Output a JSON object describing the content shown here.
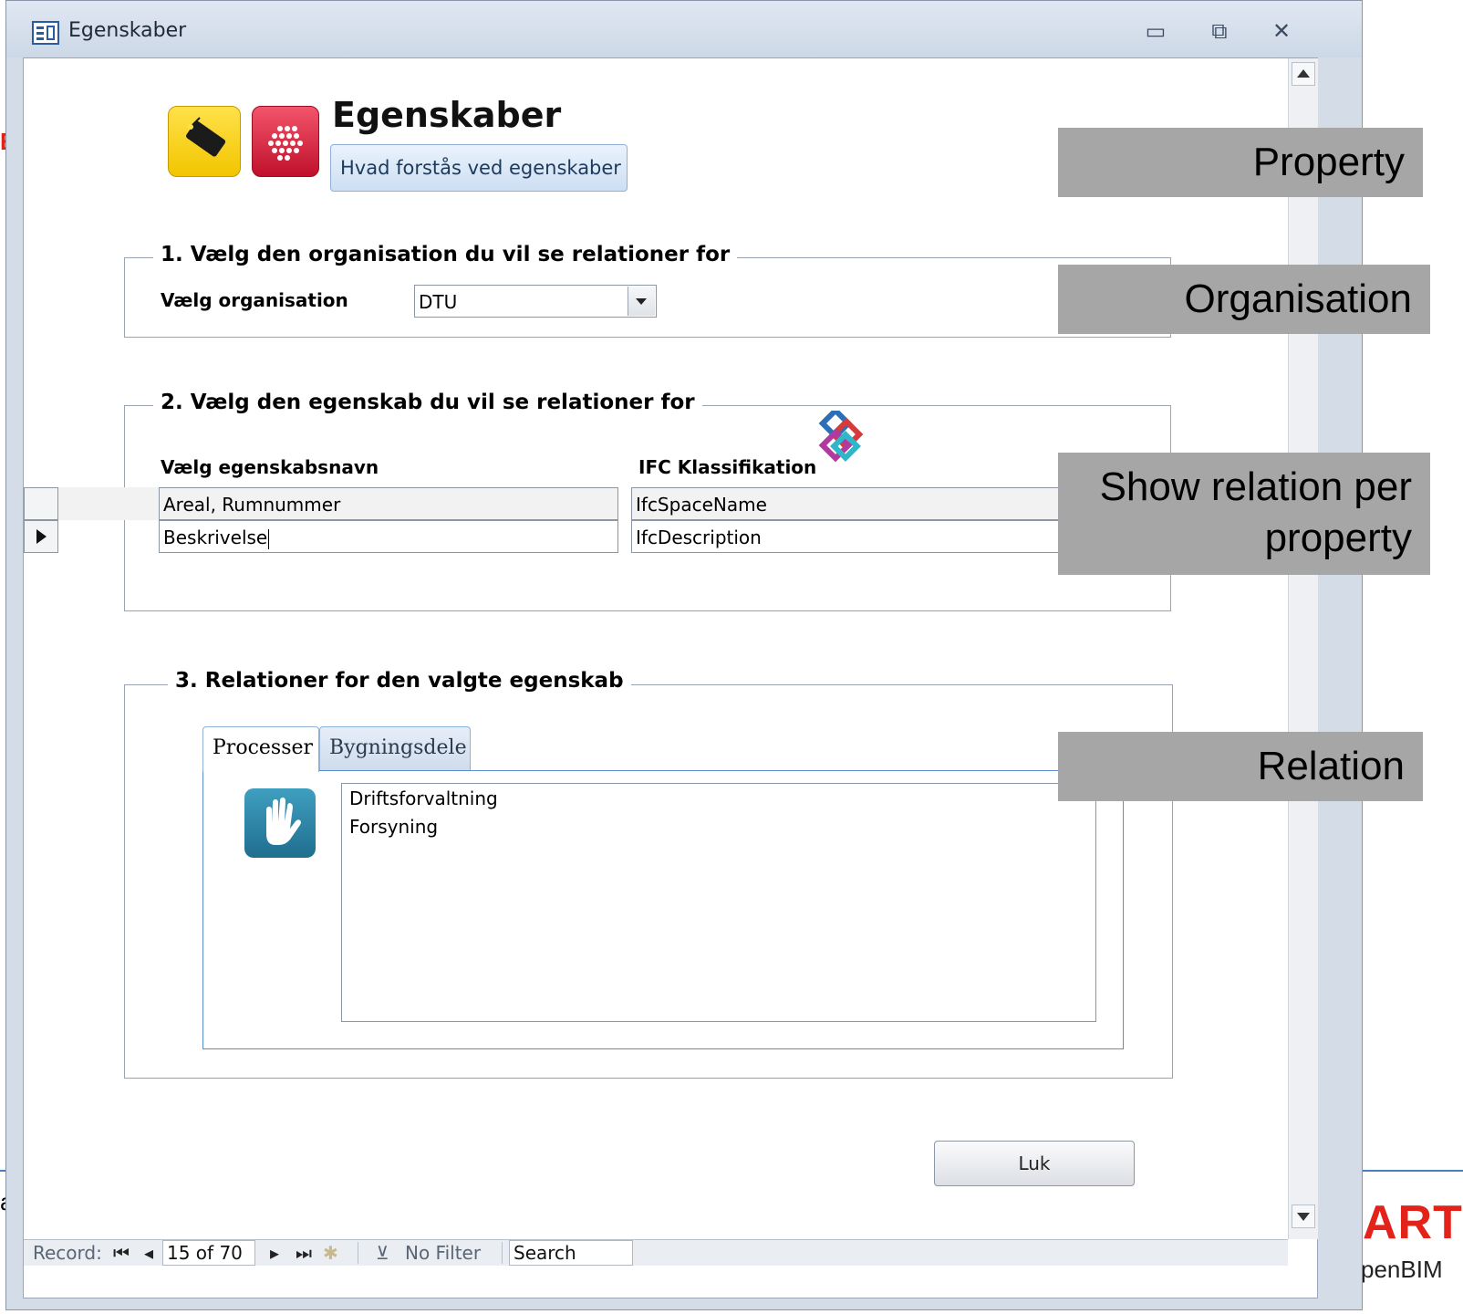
{
  "window": {
    "title": "Egenskaber",
    "controls": {
      "minimize": "▭",
      "restore": "⧉",
      "close": "✕"
    }
  },
  "form": {
    "title": "Egenskaber",
    "info_button": "Hvad forstås ved egenskaber",
    "section1": {
      "label": "1. Vælg den organisation du vil se relationer for",
      "field_label": "Vælg organisation",
      "combo_value": "DTU"
    },
    "section2": {
      "label": "2. Vælg den egenskab du vil se relationer for",
      "col1_header": "Vælg egenskabsnavn",
      "col2_header": "IFC Klassifikation",
      "rows": [
        {
          "name": "Areal, Rumnummer",
          "ifc": "IfcSpaceName"
        },
        {
          "name": "Beskrivelse",
          "ifc": "IfcDescription"
        }
      ]
    },
    "section3": {
      "label": "3. Relationer for den valgte egenskab",
      "tabs": [
        "Processer",
        "Bygningsdele"
      ],
      "list_items": [
        "Driftsforvaltning",
        "Forsyning"
      ]
    },
    "close_button": "Luk"
  },
  "navigation": {
    "record_label": "Record:",
    "record_value": "15 of 70",
    "filter_label": "No Filter",
    "search_label": "Search"
  },
  "annotations": {
    "property": "Property",
    "organisation": "Organisation",
    "show_relation_line1": "Show relation per",
    "show_relation_line2": "property",
    "relation": "Relation"
  },
  "slide": {
    "red_fragment": "E",
    "left_fragment": "a",
    "brand_top": "ART",
    "brand_bottom": "penBIM"
  },
  "colors": {
    "annotation_bg": "#a6a6a6",
    "brand_red": "#e2231a",
    "tab_border": "#5b8ed0"
  }
}
